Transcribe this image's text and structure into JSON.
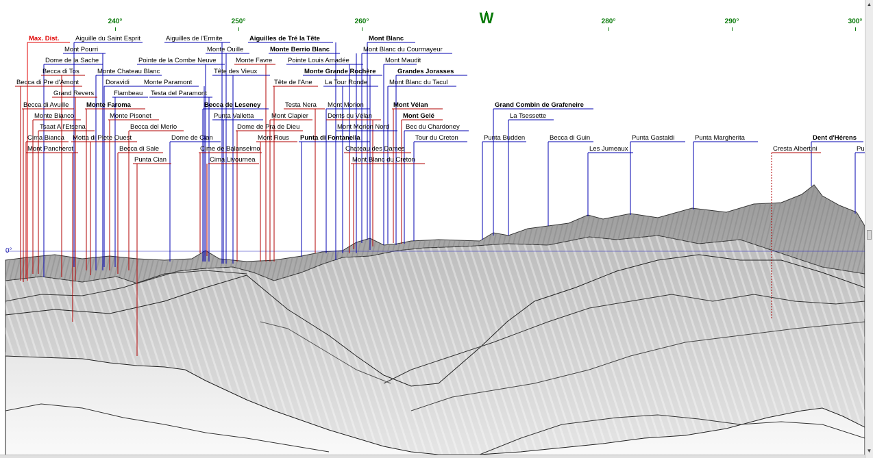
{
  "window": {
    "bg": "#ffffff"
  },
  "azimuth_scale": {
    "ticks": [
      "240°",
      "250°",
      "260°",
      "280°",
      "290°",
      "300°"
    ],
    "compass": "W",
    "color": "#0a7a0a"
  },
  "horizon_label": "0°",
  "colors": {
    "near": "#b00000",
    "far": "#0000b0",
    "highlight": "#e00000"
  },
  "peaks": [
    {
      "name": "Max. Dist.",
      "color": "red",
      "style": "red"
    },
    {
      "name": "Aiguille du Saint Esprit",
      "color": "blue"
    },
    {
      "name": "Aiguilles de l'Ermite",
      "color": "blue"
    },
    {
      "name": "Aiguilles de Tré la Tête",
      "color": "blue",
      "style": "bold"
    },
    {
      "name": "Mont Blanc",
      "color": "blue",
      "style": "bold"
    },
    {
      "name": "Mont Pourri",
      "color": "blue"
    },
    {
      "name": "Monte Ouille",
      "color": "blue"
    },
    {
      "name": "Monte Berrio Blanc",
      "color": "blue",
      "style": "bold"
    },
    {
      "name": "Mont Blanc du Courmayeur",
      "color": "blue"
    },
    {
      "name": "Dome de la Sache",
      "color": "blue"
    },
    {
      "name": "Pointe de la Combe Neuve",
      "color": "blue"
    },
    {
      "name": "Monte Favre",
      "color": "red"
    },
    {
      "name": "Pointe Louis Amadée",
      "color": "blue"
    },
    {
      "name": "Mont Maudit",
      "color": "blue"
    },
    {
      "name": "Becca di Tos",
      "color": "red"
    },
    {
      "name": "Monte Chateau Blanc",
      "color": "blue"
    },
    {
      "name": "Tête des Vieux",
      "color": "blue"
    },
    {
      "name": "Monte Grande Rochère",
      "color": "blue",
      "style": "bold"
    },
    {
      "name": "Grandes Jorasses",
      "color": "blue",
      "style": "bold"
    },
    {
      "name": "Becca di Pre d'Amont",
      "color": "red"
    },
    {
      "name": "Doravidi",
      "color": "blue"
    },
    {
      "name": "Monte Paramont",
      "color": "blue"
    },
    {
      "name": "Tête de l'Ane",
      "color": "red"
    },
    {
      "name": "La Tour Ronde",
      "color": "blue"
    },
    {
      "name": "Mont Blanc du Tacul",
      "color": "blue"
    },
    {
      "name": "Grand Revers",
      "color": "red"
    },
    {
      "name": "Flambeau",
      "color": "blue"
    },
    {
      "name": "Testa del Paramont",
      "color": "blue"
    },
    {
      "name": "Becca di Avuille",
      "color": "red"
    },
    {
      "name": "Monte Faroma",
      "color": "red",
      "style": "bold"
    },
    {
      "name": "Becca de Leseney",
      "color": "blue",
      "style": "bold"
    },
    {
      "name": "Testa Nera",
      "color": "red"
    },
    {
      "name": "Mont Morion",
      "color": "blue"
    },
    {
      "name": "Mont Vélan",
      "color": "red",
      "style": "bold"
    },
    {
      "name": "Grand Combin de Grafeneire",
      "color": "blue",
      "style": "bold"
    },
    {
      "name": "Monte Bianco",
      "color": "red"
    },
    {
      "name": "Monte Pisonet",
      "color": "red"
    },
    {
      "name": "Punta Valletta",
      "color": "blue"
    },
    {
      "name": "Mont Clapier",
      "color": "red"
    },
    {
      "name": "Dents du Vélan",
      "color": "red"
    },
    {
      "name": "Mont Gelé",
      "color": "red",
      "style": "bold"
    },
    {
      "name": "La Tsessette",
      "color": "blue"
    },
    {
      "name": "Tsaat A l'Etsena",
      "color": "red"
    },
    {
      "name": "Becca del Merlo",
      "color": "red"
    },
    {
      "name": "Dome de Pra de Dieu",
      "color": "red"
    },
    {
      "name": "Mont Morion Nord",
      "color": "blue"
    },
    {
      "name": "Bec du Chardoney",
      "color": "blue"
    },
    {
      "name": "Cima Bianca",
      "color": "red"
    },
    {
      "name": "Motta di Plete Ouest",
      "color": "red"
    },
    {
      "name": "Dome de Cian",
      "color": "blue"
    },
    {
      "name": "Mont Rous",
      "color": "red"
    },
    {
      "name": "Punta di Fontanella",
      "color": "blue",
      "style": "bold"
    },
    {
      "name": "Tour du Creton",
      "color": "blue"
    },
    {
      "name": "Punta Budden",
      "color": "blue"
    },
    {
      "name": "Becca di Guin",
      "color": "blue"
    },
    {
      "name": "Punta Gastaldi",
      "color": "blue"
    },
    {
      "name": "Punta Margherita",
      "color": "blue"
    },
    {
      "name": "Dent d'Hérens",
      "color": "blue",
      "style": "bold"
    },
    {
      "name": "Mont Pancherot",
      "color": "red"
    },
    {
      "name": "Becca di Sale",
      "color": "red"
    },
    {
      "name": "Cime de Balanselmo",
      "color": "red"
    },
    {
      "name": "Chateau des Dames",
      "color": "red"
    },
    {
      "name": "Les Jumeaux",
      "color": "blue"
    },
    {
      "name": "Cresta Albertini",
      "color": "red"
    },
    {
      "name": "Pu",
      "color": "blue"
    },
    {
      "name": "Punta Cian",
      "color": "red"
    },
    {
      "name": "Cima Livournea",
      "color": "red"
    },
    {
      "name": "Mont Blanc du Creton",
      "color": "red"
    }
  ]
}
